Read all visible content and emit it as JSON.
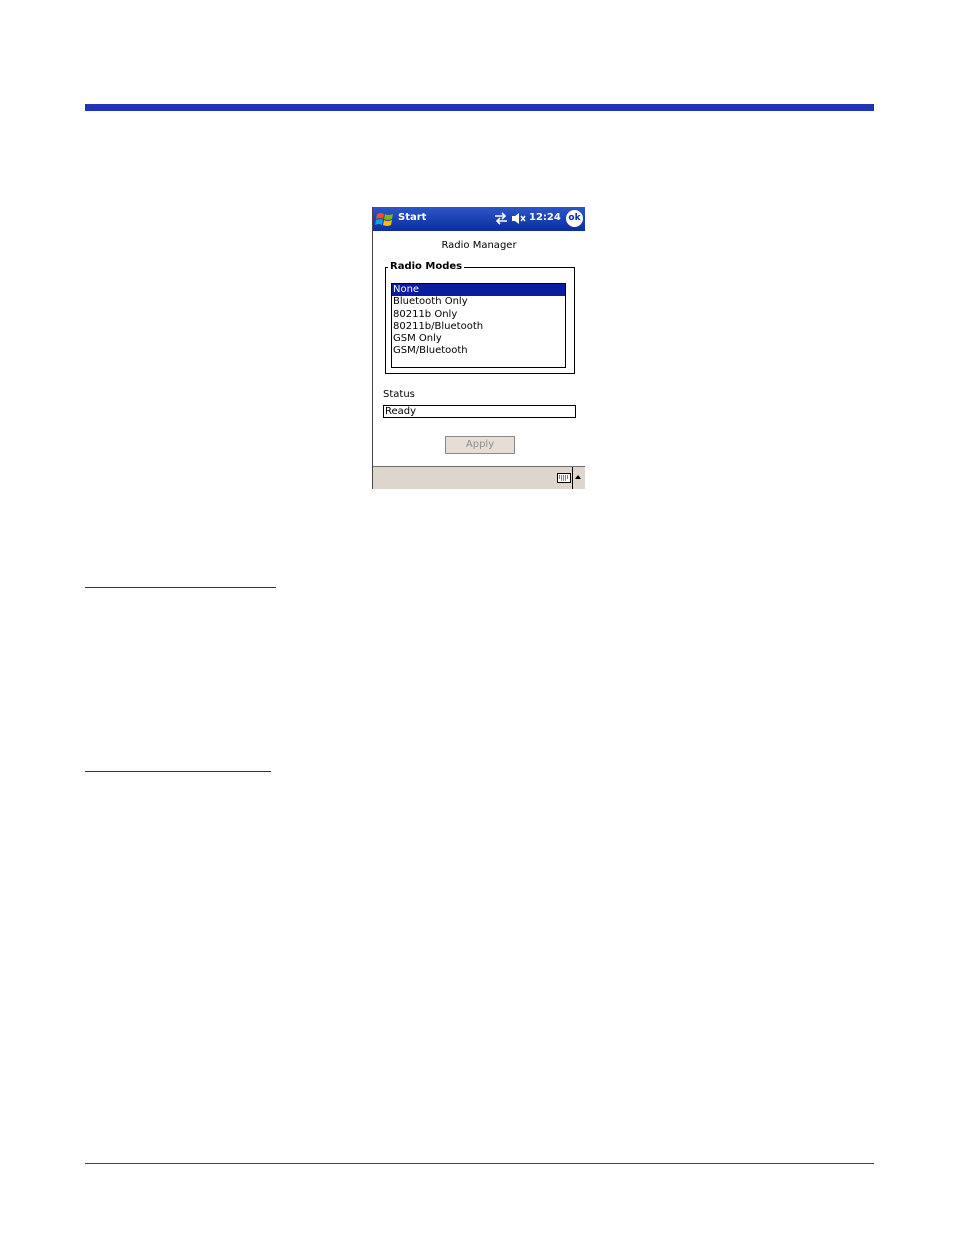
{
  "device": {
    "titlebar": {
      "start_label": "Start",
      "clock": "12:24",
      "ok_label": "ok",
      "icons": [
        "windows-flag-icon",
        "connectivity-icon",
        "volume-muted-icon"
      ]
    },
    "app_title": "Radio Manager",
    "radio_modes": {
      "legend": "Radio Modes",
      "items": [
        "None",
        "Bluetooth Only",
        "80211b Only",
        "80211b/Bluetooth",
        "GSM Only",
        "GSM/Bluetooth"
      ],
      "selected": "None"
    },
    "status": {
      "label": "Status",
      "value": "Ready"
    },
    "apply_label": "Apply",
    "menubar": {
      "icons": [
        "keyboard-icon",
        "sip-up-arrow-icon"
      ]
    }
  },
  "colors": {
    "accent": "#1f35b5",
    "selection": "#0a1d9f",
    "menubar": "#ded6cc"
  }
}
